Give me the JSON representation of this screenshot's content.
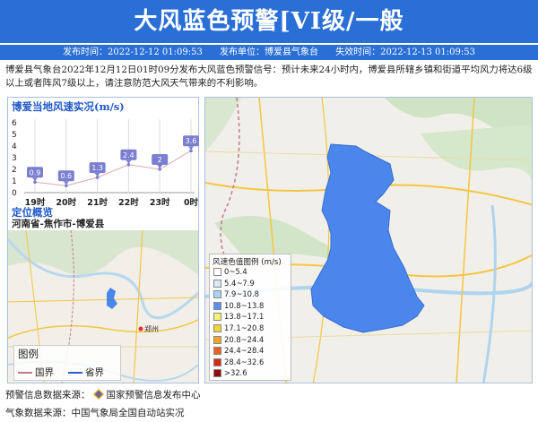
{
  "header": {
    "title": "大风蓝色预警[VI级/一般",
    "publish_time": "发布时间：2022-12-12 01:09:53",
    "publisher": "发布单位：博爱县气象台",
    "expire_time": "失效时间：2022-12-13 01:09:53"
  },
  "description": "博爱县气象台2022年12月12日01时09分发布大风蓝色预警信号：预计未来24小时内，博爱县所辖乡镇和街道平均风力将达6级以上或者阵风7级以上，请注意防范大风天气带来的不利影响。",
  "wind_panel": {
    "title": "博爱当地风速实况",
    "unit": "(m/s)"
  },
  "chart_data": {
    "type": "line",
    "title": "博爱当地风速实况(m/s)",
    "categories": [
      "19时",
      "20时",
      "21时",
      "22时",
      "23时",
      "0时"
    ],
    "values": [
      0.9,
      0.6,
      1.3,
      2.4,
      2.0,
      3.6
    ],
    "value_labels": [
      "0.9",
      "0.6",
      "1.3",
      "2.4",
      "2",
      "3.6"
    ],
    "ylim": [
      0,
      6
    ],
    "yticks": [
      "0",
      "1",
      "2",
      "3",
      "4",
      "5",
      "6"
    ],
    "grid": "vertical",
    "color": "#7b7fd0"
  },
  "location": {
    "title": "定位概览",
    "path": "河南省-焦作市-博爱县"
  },
  "legend": {
    "title": "图例",
    "country_border": "国界",
    "province_border": "省界",
    "country_color": "#c47a8a",
    "province_color": "#2b5fc7"
  },
  "wind_scale": {
    "title": "风速色值图例 (m/s)",
    "rows": [
      {
        "label": "0~5.4",
        "color": "#ffffff"
      },
      {
        "label": "5.4~7.9",
        "color": "#d6ecfb"
      },
      {
        "label": "7.9~10.8",
        "color": "#a9d4f5"
      },
      {
        "label": "10.8~13.8",
        "color": "#5a8ff0"
      },
      {
        "label": "13.8~17.1",
        "color": "#f7f27a"
      },
      {
        "label": "17.1~20.8",
        "color": "#f5d23a"
      },
      {
        "label": "20.8~24.4",
        "color": "#f0a423"
      },
      {
        "label": "24.4~28.4",
        "color": "#e8641e"
      },
      {
        "label": "28.4~32.6",
        "color": "#d42a14"
      },
      {
        "label": ">32.6",
        "color": "#8e0b0b"
      }
    ]
  },
  "footer": {
    "warning_source_label": "预警信息数据来源：",
    "warning_source": "国家预警信息发布中心",
    "weather_source_label": "气象数据来源：",
    "weather_source": "中国气象局全国自动站实况"
  },
  "map_labels": {
    "city": "郑州"
  },
  "colors": {
    "accent": "#2a6fd6",
    "region_fill": "#4a86ec"
  }
}
